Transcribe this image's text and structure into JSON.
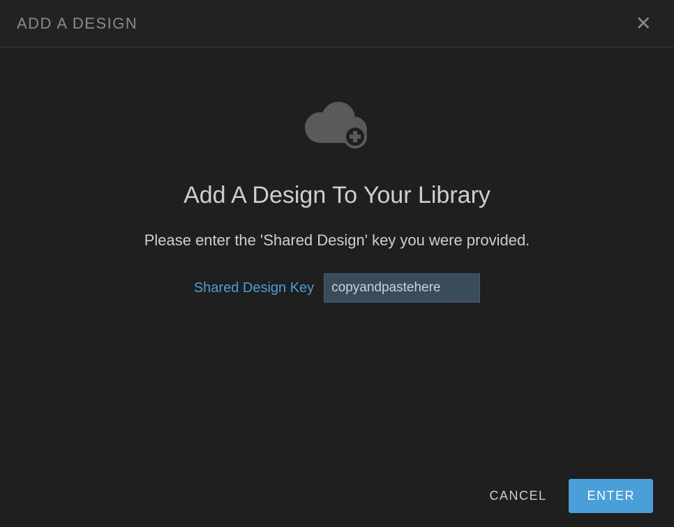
{
  "header": {
    "title": "ADD A DESIGN"
  },
  "body": {
    "heading": "Add A Design To Your Library",
    "instruction": "Please enter the 'Shared Design' key you were provided.",
    "input_label": "Shared Design Key",
    "input_value": "copyandpastehere"
  },
  "footer": {
    "cancel_label": "CANCEL",
    "enter_label": "ENTER"
  }
}
